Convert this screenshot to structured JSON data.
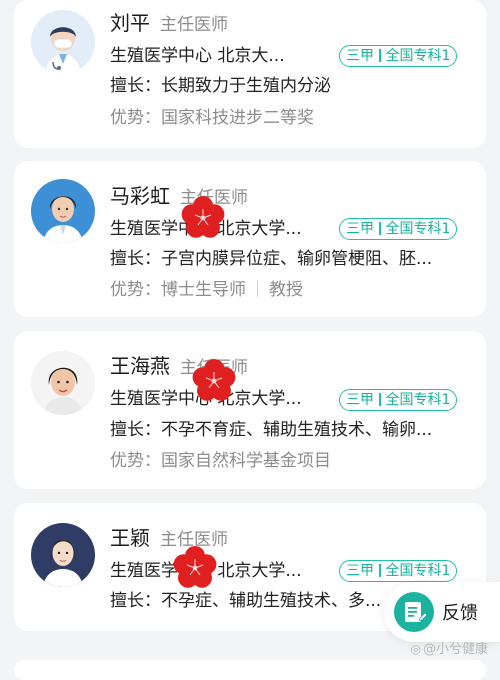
{
  "doctors": [
    {
      "name": "刘平",
      "title": "主任医师",
      "dept": "生殖医学中心  北京大...",
      "badge": {
        "level": "三甲",
        "tag": "全国专科1"
      },
      "skill": "擅长：长期致力于生殖内分泌",
      "advantage_label": "优势：",
      "advantages": [
        "国家科技进步二等奖"
      ],
      "avatar": "doctor-cartoon-avatar"
    },
    {
      "name": "马彩虹",
      "title": "主任医师",
      "dept": "生殖医学中心  北京大学...",
      "badge": {
        "level": "三甲",
        "tag": "全国专科1"
      },
      "skill": "擅长：子宫内膜异位症、输卵管梗阻、胚...",
      "advantage_label": "优势：",
      "advantages": [
        "博士生导师",
        "教授"
      ],
      "avatar": "doctor-photo-avatar"
    },
    {
      "name": "王海燕",
      "title": "主任医师",
      "dept": "生殖医学中心  北京大学...",
      "badge": {
        "level": "三甲",
        "tag": "全国专科1"
      },
      "skill": "擅长：不孕不育症、辅助生殖技术、输卵...",
      "advantage_label": "优势：",
      "advantages": [
        "国家自然科学基金项目"
      ],
      "avatar": "doctor-photo-avatar"
    },
    {
      "name": "王颖",
      "title": "主任医师",
      "dept": "生殖医学中心  北京大学...",
      "badge": {
        "level": "三甲",
        "tag": "全国专科1"
      },
      "skill": "擅长：不孕症、辅助生殖技术、多...",
      "avatar": "doctor-photo-avatar"
    }
  ],
  "feedback": {
    "label": "反馈",
    "icon": "edit-note-icon"
  },
  "watermark": {
    "text": "@小兮健康",
    "icon": "xiaohongshu-logo-icon"
  },
  "colors": {
    "badge": "#18b39c",
    "feedback_icon_bg": "#1bb3a0",
    "flower": "#e02020",
    "page_bg": "#f3f4f6"
  }
}
